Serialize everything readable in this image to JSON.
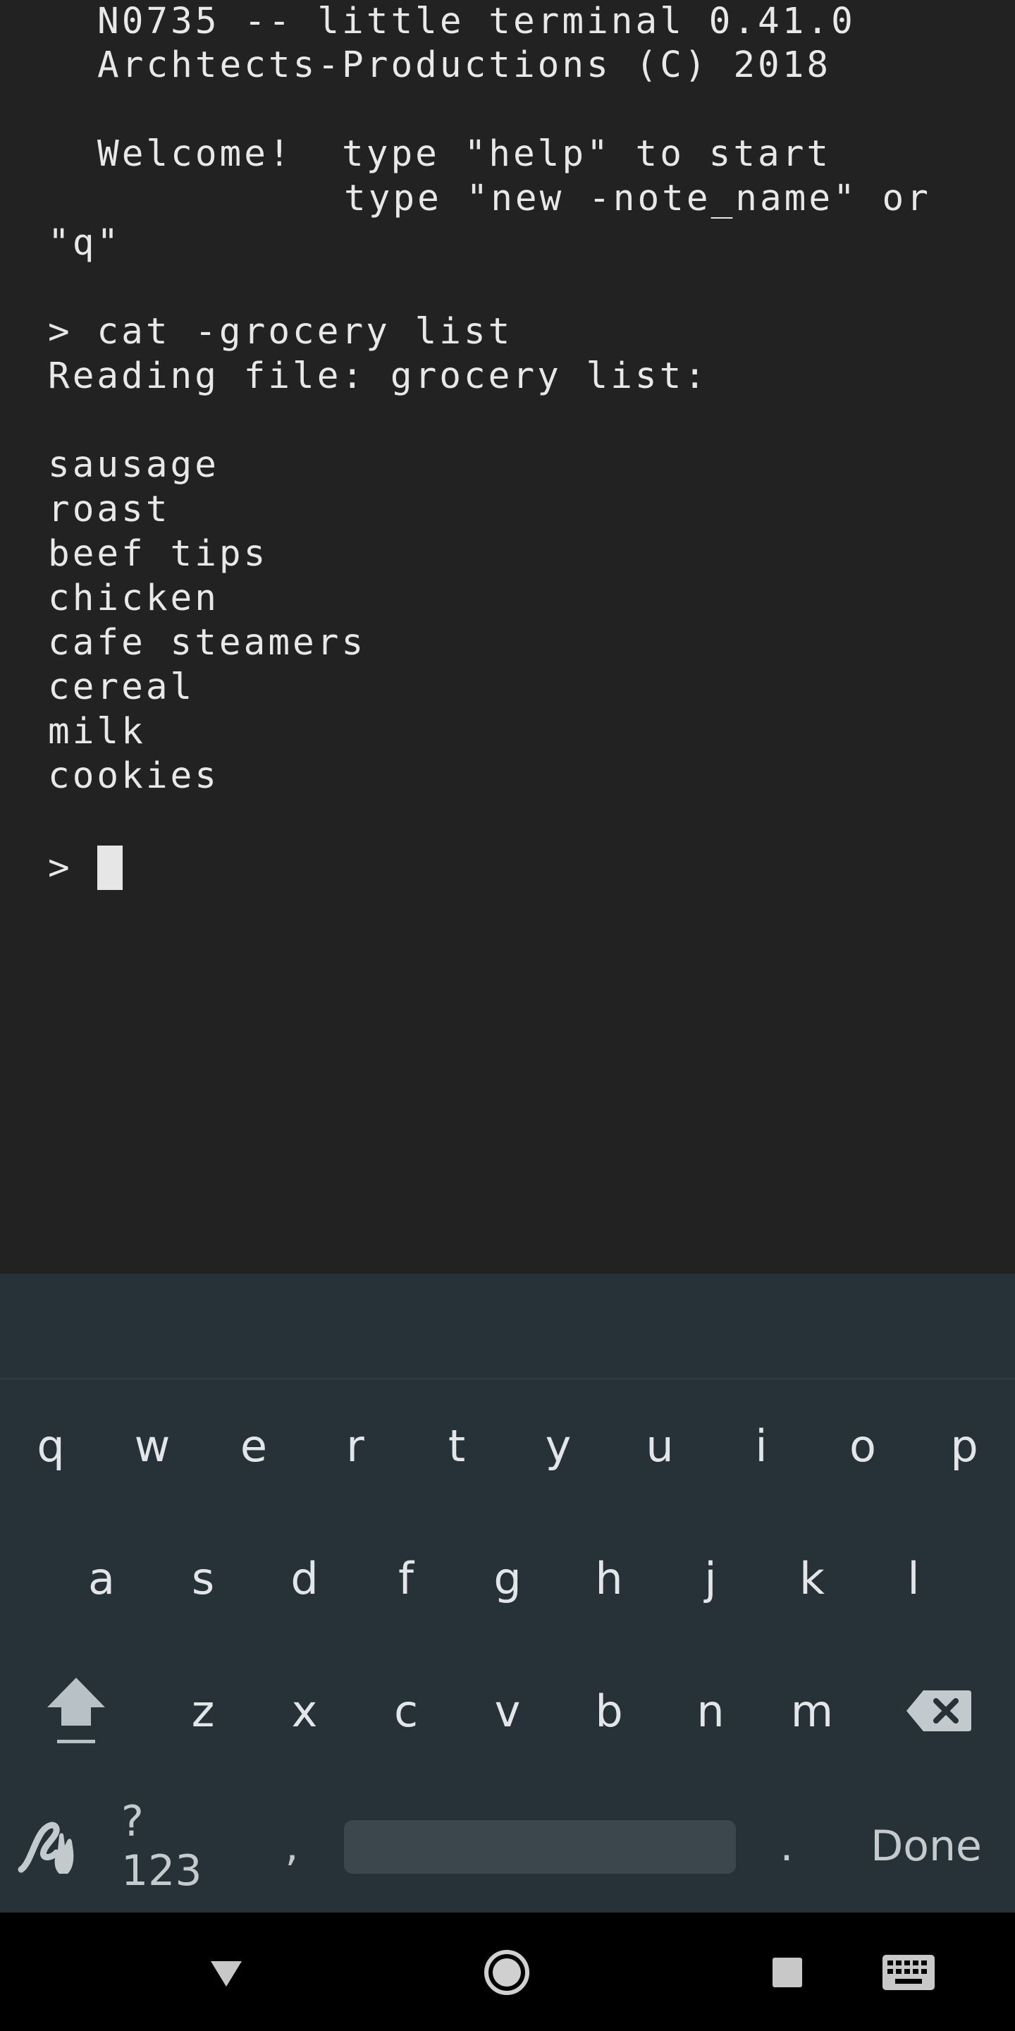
{
  "terminal": {
    "lines": [
      "N0735 -- little terminal 0.41.0",
      "Archtects-Productions (C) 2018",
      "Welcome!  type \"help\" to start",
      "type \"new -note_name\" or",
      "\"q\"",
      "> cat -grocery list",
      "Reading file: grocery list:",
      "sausage",
      "roast",
      "beef tips",
      "chicken",
      "cafe steamers",
      "cereal",
      "milk",
      "cookies",
      ">"
    ]
  },
  "keyboard": {
    "row1": [
      "q",
      "w",
      "e",
      "r",
      "t",
      "y",
      "u",
      "i",
      "o",
      "p"
    ],
    "row2": [
      "a",
      "s",
      "d",
      "f",
      "g",
      "h",
      "j",
      "k",
      "l"
    ],
    "row3": [
      "z",
      "x",
      "c",
      "v",
      "b",
      "n",
      "m"
    ],
    "symbols_label": "?123",
    "comma_label": ",",
    "period_label": ".",
    "done_label": "Done",
    "icons": {
      "shift": "shift-icon",
      "backspace": "backspace-icon",
      "handwriting": "handwriting-icon",
      "back": "back-icon",
      "home": "home-icon",
      "recents": "recents-icon",
      "keyboard": "keyboard-icon"
    },
    "colors": {
      "background": "#263238",
      "key_text": "#e3e6e8",
      "shift_accent": "#b8c1c6"
    }
  }
}
